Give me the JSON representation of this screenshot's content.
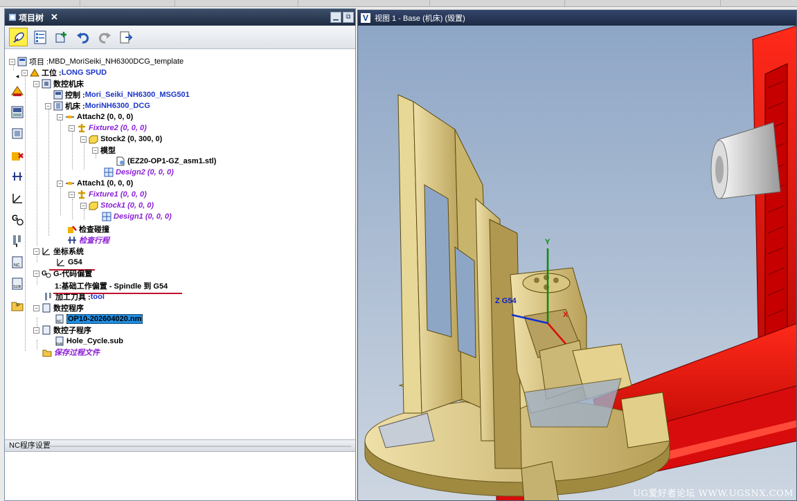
{
  "left_panel": {
    "tab_title": "项目树",
    "close_label": "✕",
    "minimize_label": "▁",
    "restore_label": "⧉"
  },
  "toolbar": {
    "buttons": [
      "cursor-icon",
      "project-tree-icon",
      "add-node-icon",
      "undo-icon",
      "redo-icon",
      "export-icon"
    ]
  },
  "sidebar": {
    "collapse_arrow": "◂",
    "icons": [
      "machine-icon",
      "control-icon",
      "machine-axis-icon",
      "collision-icon",
      "travel-icon",
      "coordinate-icon",
      "gcode-offset-icon",
      "tool-icon",
      "nc-program-icon",
      "nc-subprogram-icon",
      "save-process-icon"
    ]
  },
  "tree": {
    "project_prefix": "项目 : ",
    "project_name": "MBD_MoriSeiki_NH6300DCG_template",
    "setup_prefix": "工位 : ",
    "setup_name": "LONG SPUD",
    "cnc_machine": "数控机床",
    "control_prefix": "控制 : ",
    "control_name": "Mori_Seiki_NH6300_MSG501",
    "machine_prefix": "机床 : ",
    "machine_name": "MoriNH6300_DCG",
    "attach2": "Attach2 (0, 0, 0)",
    "fixture2": "Fixture2 (0, 0, 0)",
    "stock2": "Stock2 (0, 300, 0)",
    "model": "模型",
    "stl_file": "(EZ20-OP1-GZ_asm1.stl)",
    "design2": "Design2 (0, 0, 0)",
    "attach1": "Attach1 (0, 0, 0)",
    "fixture1": "Fixture1 (0, 0, 0)",
    "stock1": "Stock1 (0, 0, 0)",
    "design1": "Design1 (0, 0, 0)",
    "collision_check": "检查碰撞",
    "travel_check": "检查行程",
    "coord_system": "坐标系统",
    "g54": "G54",
    "gcode_offset": "G-代码偏置",
    "base_offset": "1:基础工作偏置 - Spindle 到 G54",
    "tool_prefix": "加工刀具 : ",
    "tool_name": "tool",
    "nc_program": "数控程序",
    "nc_file": "OP10-202604020.nm",
    "nc_subprogram": "数控子程序",
    "sub_file": "Hole_Cycle.sub",
    "save_process": "保存过程文件"
  },
  "nc_settings": {
    "title": "NC程序设置"
  },
  "viewport": {
    "logo": "V",
    "title": "视图 1 - Base (机床) (毁置)",
    "axis_y": "Y",
    "axis_x": "X",
    "axis_z_label": "Z G54",
    "watermark": "UG爱好者论坛 WWW.UGSNX.COM",
    "colors": {
      "background_top": "#8ea6c6",
      "background_bottom": "#c9d3df",
      "machine_red": "#e01010",
      "fixture_gold": "#d8c27a"
    }
  }
}
